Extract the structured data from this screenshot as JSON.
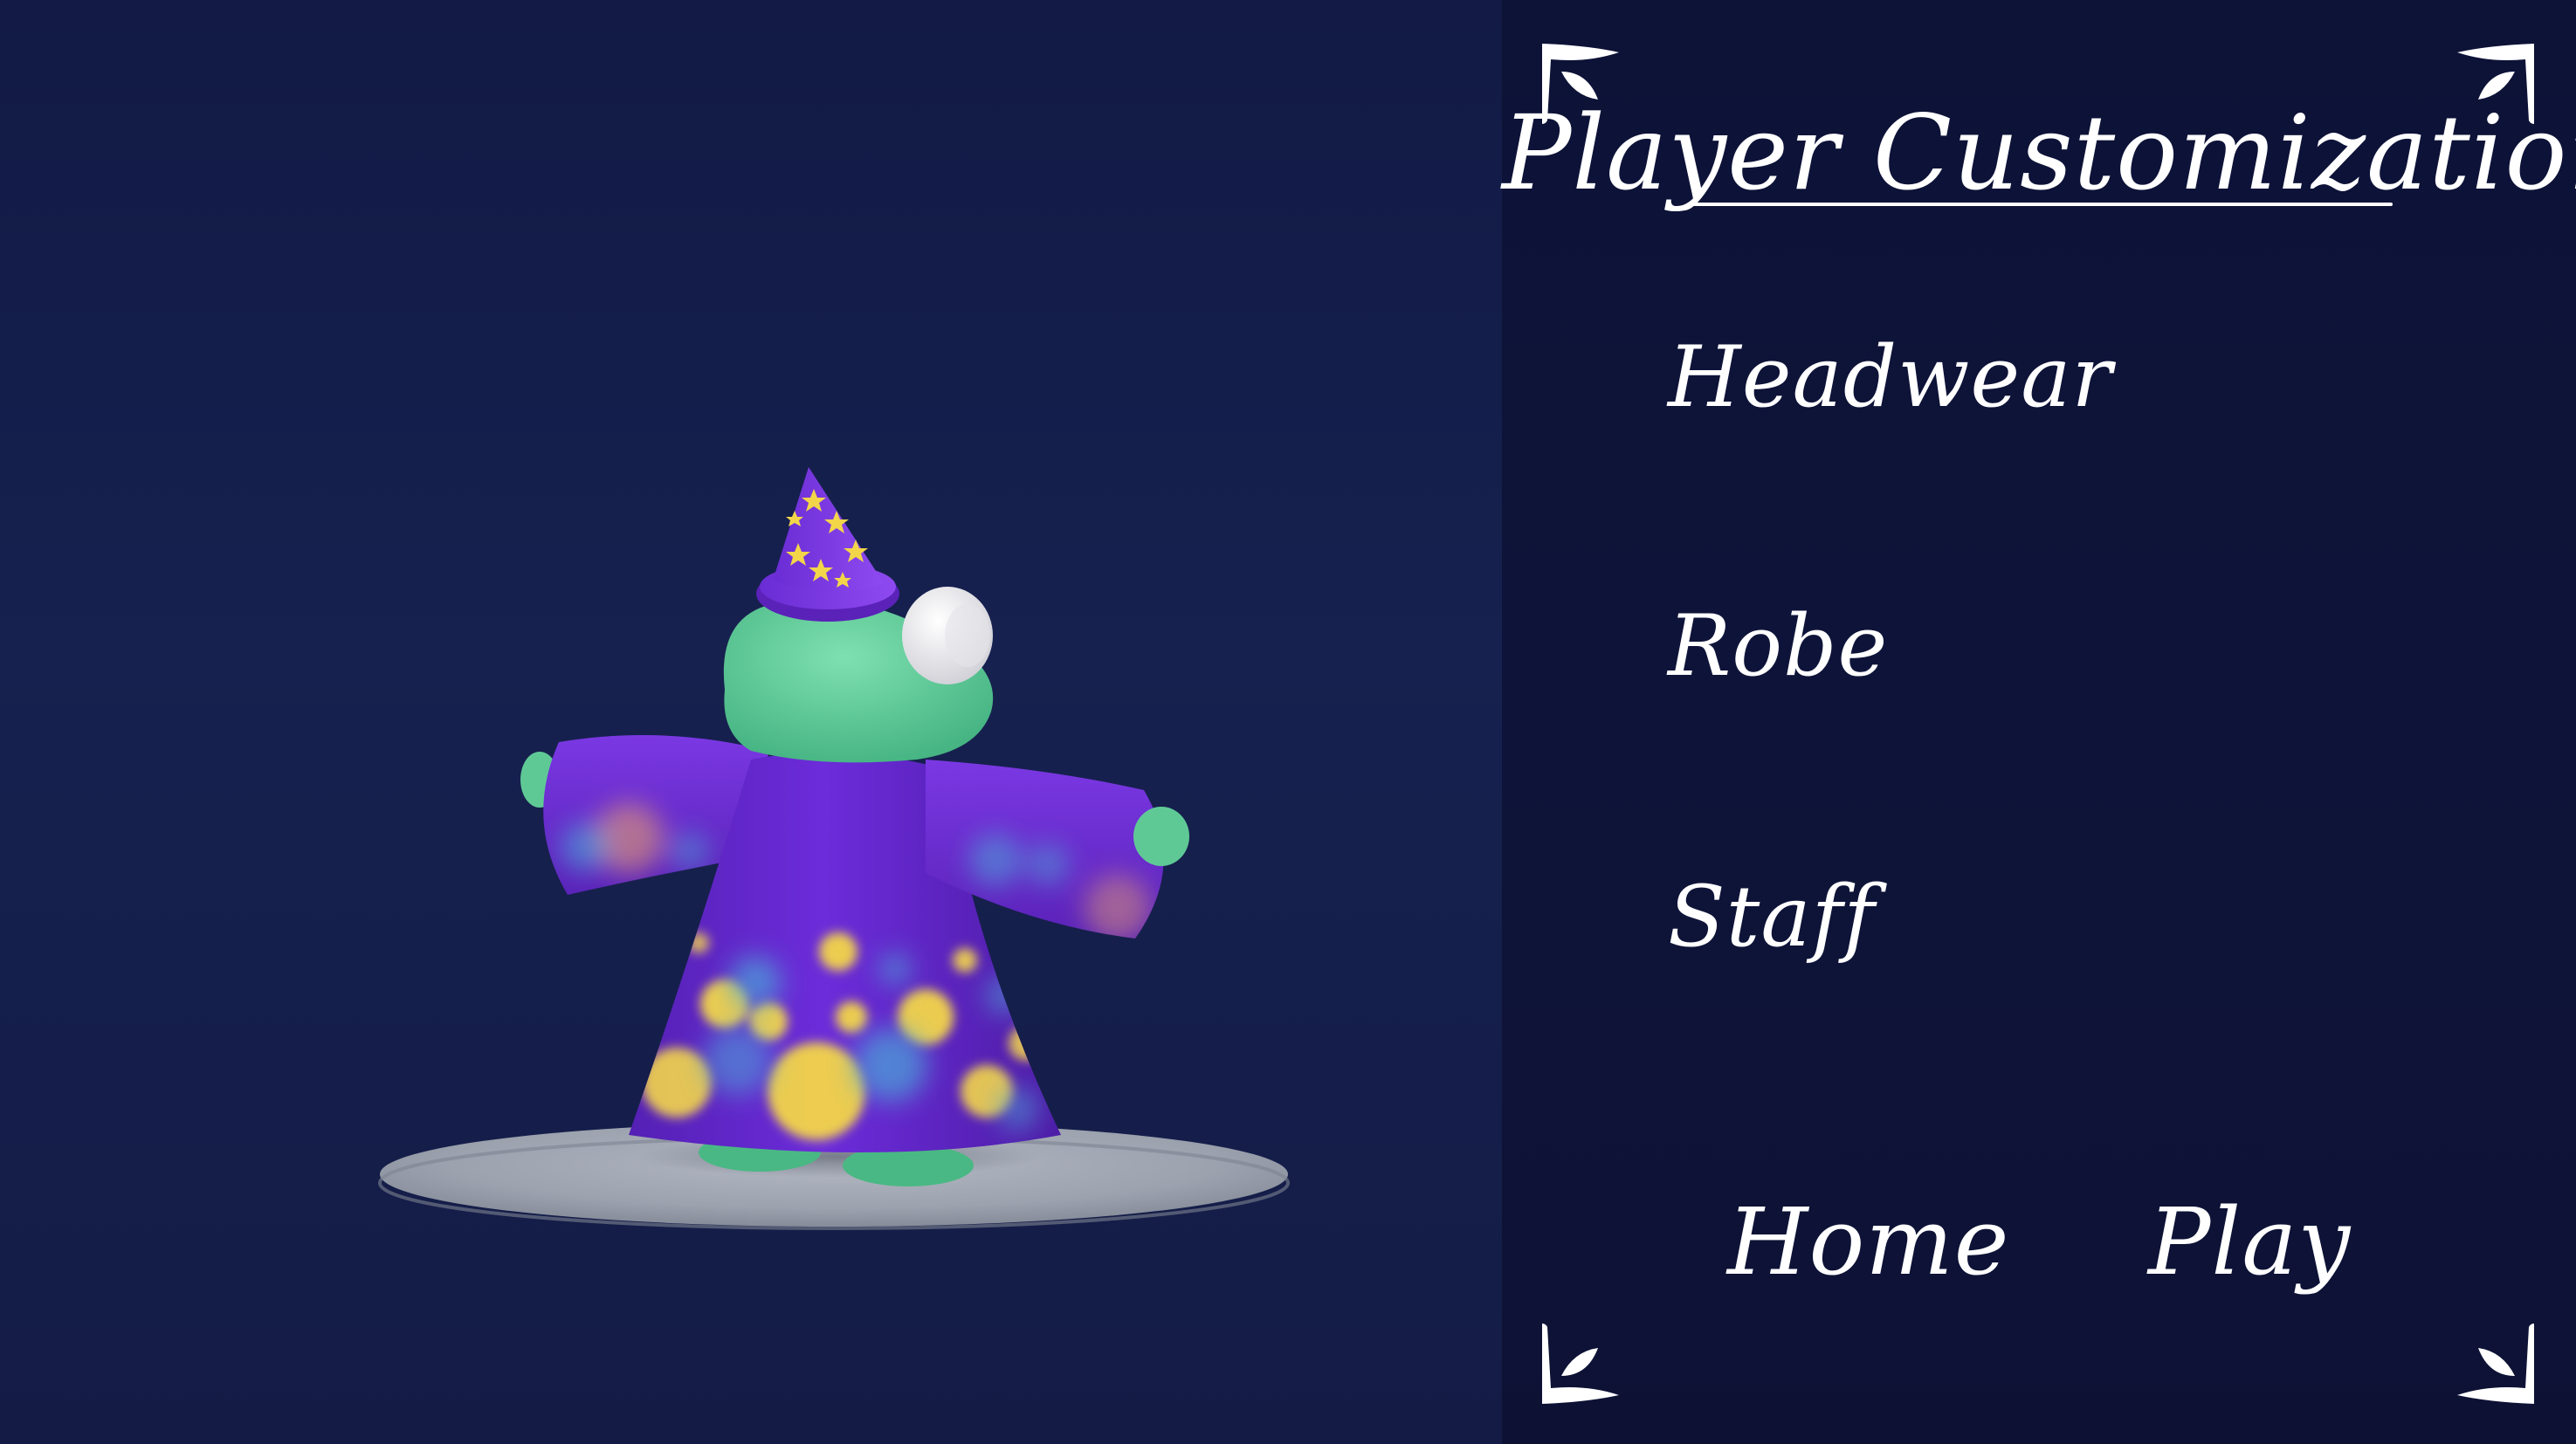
{
  "panel": {
    "title": "Player Customization",
    "categories": [
      {
        "label": "Headwear"
      },
      {
        "label": "Robe"
      },
      {
        "label": "Staff"
      }
    ],
    "buttons": {
      "home": "Home",
      "play": "Play"
    }
  },
  "colors": {
    "viewport_bg": "#16214f",
    "panel_bg": "#0e1439",
    "text": "#ffffff",
    "robe": "#6a2bd6",
    "skin": "#5fd19a",
    "hat_star": "#f3d54a",
    "pedestal": "#9aa0ad"
  },
  "icons": {
    "corner_ornament": "leaf-corner-icon"
  }
}
